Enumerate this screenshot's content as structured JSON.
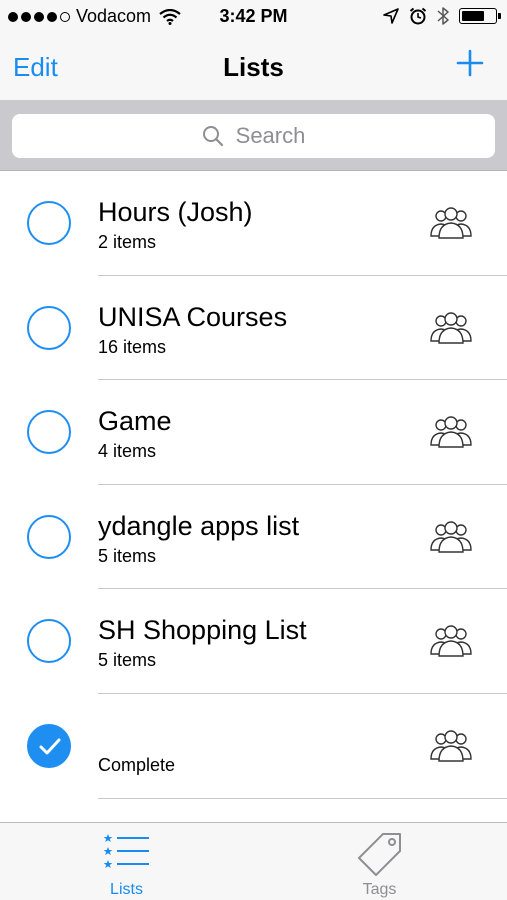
{
  "status_bar": {
    "carrier": "Vodacom",
    "time": "3:42 PM",
    "signal_bars": 4,
    "signal_total": 5
  },
  "nav": {
    "edit_label": "Edit",
    "title": "Lists",
    "add_icon": "plus-icon"
  },
  "search": {
    "placeholder": "Search"
  },
  "lists": [
    {
      "title": "Hours (Josh)",
      "subtitle": "2 items",
      "completed": false
    },
    {
      "title": "UNISA Courses",
      "subtitle": "16 items",
      "completed": false
    },
    {
      "title": "Game",
      "subtitle": "4 items",
      "completed": false
    },
    {
      "title": "ydangle apps list",
      "subtitle": "5 items",
      "completed": false
    },
    {
      "title": "SH Shopping List",
      "subtitle": "5 items",
      "completed": false
    },
    {
      "title": "",
      "subtitle": "Complete",
      "completed": true
    }
  ],
  "tabs": [
    {
      "label": "Lists",
      "icon": "list-icon",
      "active": true
    },
    {
      "label": "Tags",
      "icon": "tag-icon",
      "active": false
    }
  ],
  "colors": {
    "accent": "#1a8cf0",
    "check_blue": "#1f8ef1",
    "separator": "#c8c7cc",
    "search_bg": "#c9c9ce",
    "bar_bg": "#f7f7f7",
    "inactive_gray": "#8e8e93"
  }
}
